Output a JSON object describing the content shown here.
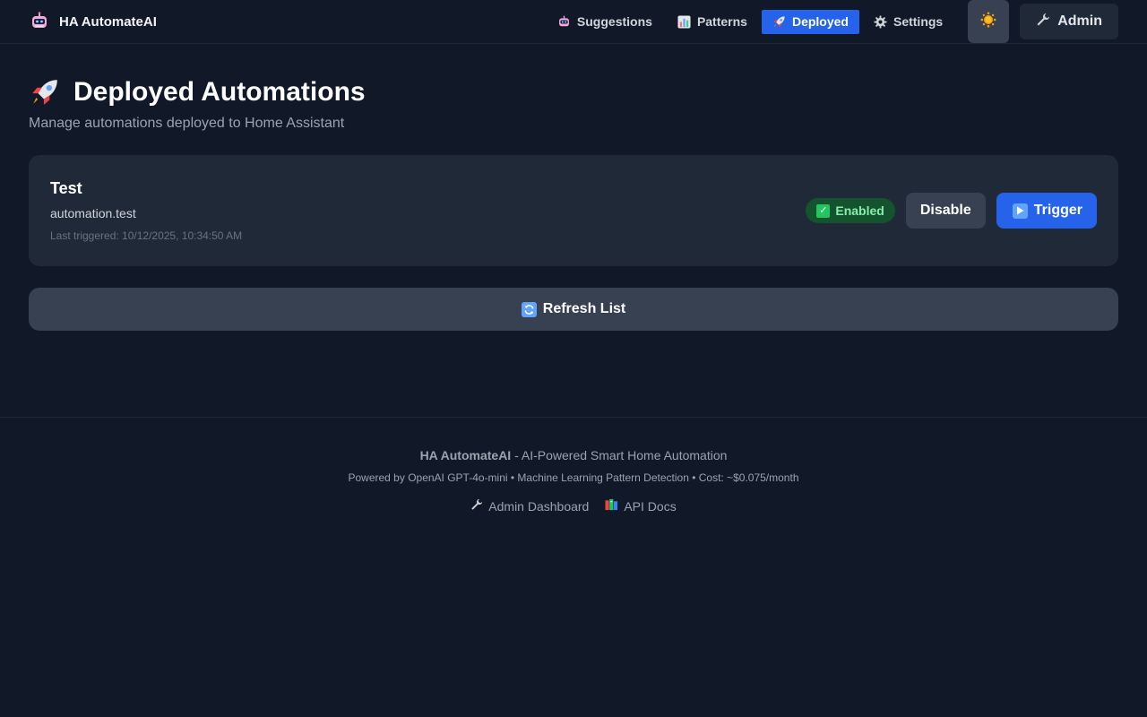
{
  "app": {
    "brand_name": "HA AutomateAI",
    "brand_icon": "robot-icon"
  },
  "nav": {
    "items": [
      {
        "label": "Suggestions",
        "icon": "robot-icon",
        "active": false
      },
      {
        "label": "Patterns",
        "icon": "bar-chart-icon",
        "active": false
      },
      {
        "label": "Deployed",
        "icon": "rocket-icon",
        "active": true
      },
      {
        "label": "Settings",
        "icon": "gear-icon",
        "active": false
      }
    ],
    "theme_icon": "sun-icon",
    "admin_label": "Admin",
    "admin_icon": "wrench-icon"
  },
  "page": {
    "title": "Deployed Automations",
    "title_icon": "rocket-icon",
    "subtitle": "Manage automations deployed to Home Assistant"
  },
  "automations": [
    {
      "name": "Test",
      "entity_id": "automation.test",
      "last_triggered": "Last triggered: 10/12/2025, 10:34:50 AM",
      "status": "Enabled",
      "disable_label": "Disable",
      "trigger_label": "Trigger"
    }
  ],
  "refresh_label": "Refresh List",
  "footer": {
    "brand": "HA AutomateAI",
    "tagline": " - AI-Powered Smart Home Automation",
    "powered_by": "Powered by OpenAI GPT-4o-mini • Machine Learning Pattern Detection • Cost: ~$0.075/month",
    "links": [
      {
        "label": "Admin Dashboard",
        "icon": "wrench-icon"
      },
      {
        "label": "API Docs",
        "icon": "books-icon"
      }
    ]
  },
  "colors": {
    "background": "#111827",
    "card": "#1f2937",
    "accent": "#2563eb",
    "success": "#22c55e"
  }
}
